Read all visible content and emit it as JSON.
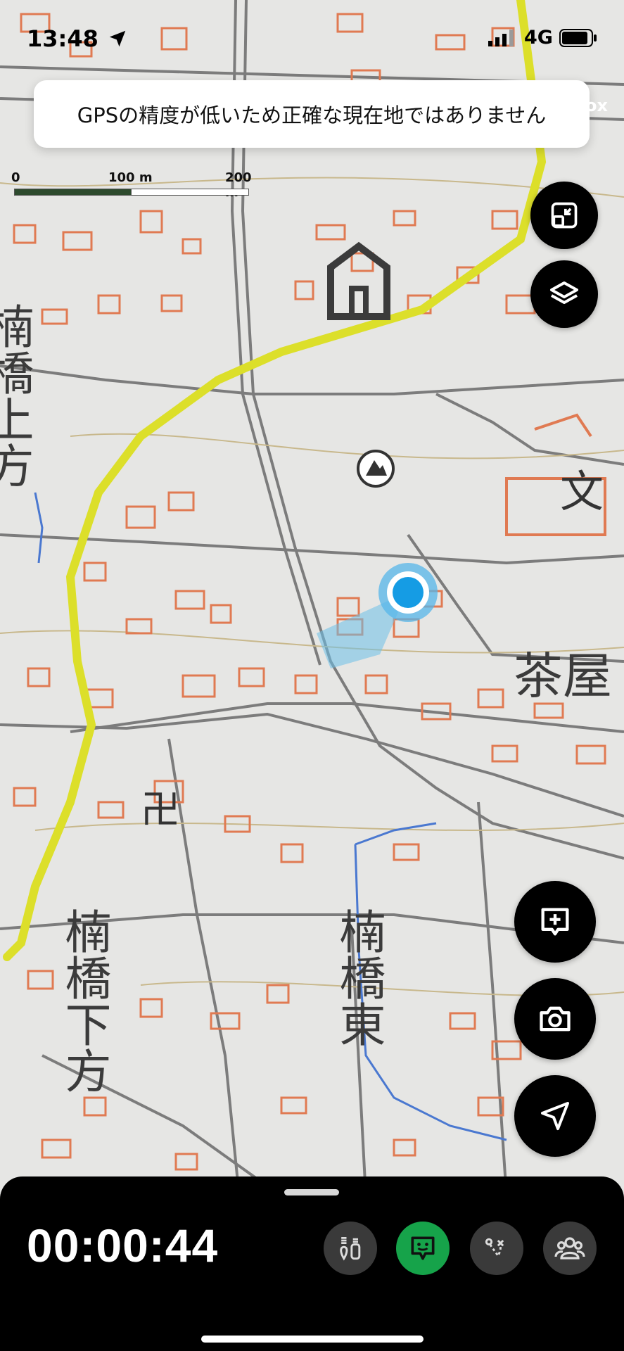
{
  "status_bar": {
    "time": "13:48",
    "network": "4G"
  },
  "toast": {
    "message": "GPSの精度が低いため正確な現在地ではありません"
  },
  "attribution_fragment": "ox",
  "scale_bar": {
    "labels": [
      "0",
      "100 m",
      "200 m"
    ]
  },
  "map": {
    "place_labels": [
      "楠橋上方",
      "茶屋",
      "楠橋下方",
      "楠橋東"
    ],
    "map_symbols": [
      "temple-symbol",
      "school-symbol",
      "shrine-symbol",
      "summit-icon"
    ]
  },
  "buttons": {
    "collapse": "collapse-map-icon",
    "layers": "layers-icon",
    "add_note": "add-note-icon",
    "camera": "camera-icon",
    "locate": "locate-icon"
  },
  "recording": {
    "elapsed": "00:00:44",
    "toolbar": [
      "altitude-icon",
      "chat-icon",
      "route-icon",
      "group-icon"
    ],
    "active_tool": "chat-icon"
  }
}
